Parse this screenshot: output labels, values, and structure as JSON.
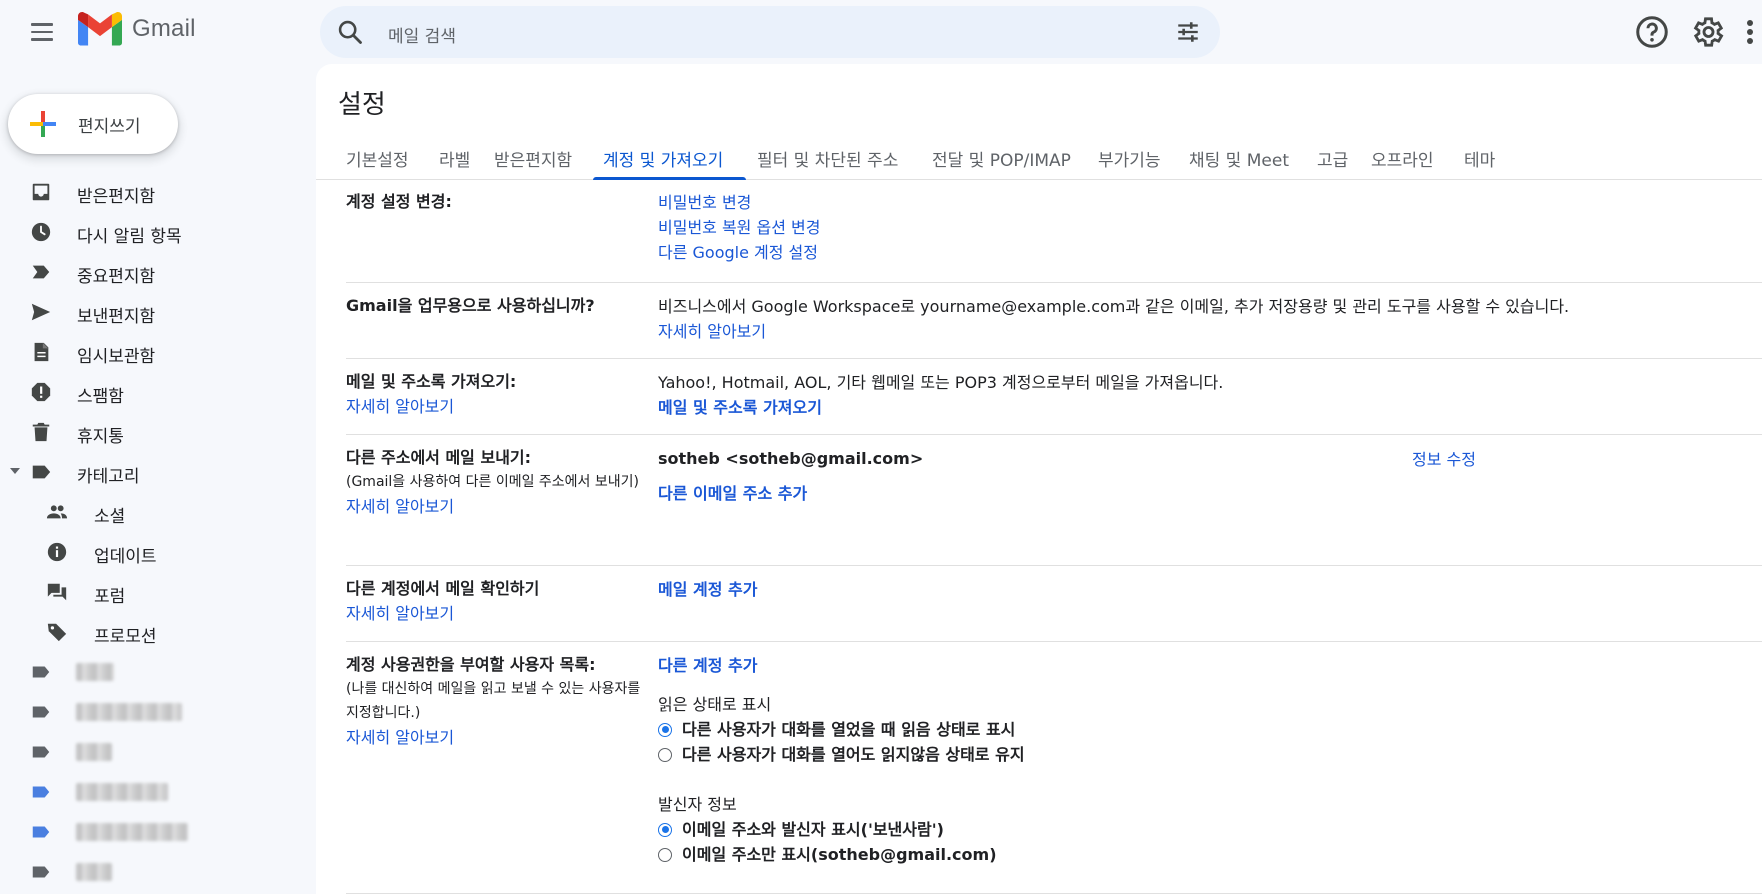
{
  "app": {
    "name": "Gmail"
  },
  "search": {
    "placeholder": "메일 검색"
  },
  "compose": {
    "label": "편지쓰기"
  },
  "sidebar": {
    "items": [
      {
        "label": "받은편지함",
        "icon": "inbox-icon"
      },
      {
        "label": "다시 알림 항목",
        "icon": "clock-icon"
      },
      {
        "label": "중요편지함",
        "icon": "important-icon"
      },
      {
        "label": "보낸편지함",
        "icon": "send-icon"
      },
      {
        "label": "임시보관함",
        "icon": "draft-icon"
      },
      {
        "label": "스팸함",
        "icon": "spam-icon"
      },
      {
        "label": "휴지통",
        "icon": "trash-icon"
      },
      {
        "label": "카테고리",
        "icon": "label-icon"
      }
    ],
    "categories": [
      {
        "label": "소셜",
        "icon": "people-icon"
      },
      {
        "label": "업데이트",
        "icon": "info-icon"
      },
      {
        "label": "포럼",
        "icon": "forum-icon"
      },
      {
        "label": "프로모션",
        "icon": "tag-icon"
      }
    ],
    "labels": [
      {
        "color": "#5f6368"
      },
      {
        "color": "#5f6368"
      },
      {
        "color": "#5f6368"
      },
      {
        "color": "#4a7fe0"
      },
      {
        "color": "#4a7fe0"
      },
      {
        "color": "#5f6368"
      }
    ]
  },
  "settings": {
    "title": "설정",
    "tabs": [
      "기본설정",
      "라벨",
      "받은편지함",
      "계정 및 가져오기",
      "필터 및 차단된 주소",
      "전달 및 POP/IMAP",
      "부가기능",
      "채팅 및 Meet",
      "고급",
      "오프라인",
      "테마"
    ],
    "active_tab": "계정 및 가져오기",
    "rows": {
      "change_account": {
        "label": "계정 설정 변경:",
        "links": [
          "비밀번호 변경",
          "비밀번호 복원 옵션 변경",
          "다른 Google 계정 설정"
        ]
      },
      "workspace": {
        "label": "Gmail을 업무용으로 사용하십니까?",
        "text": "비즈니스에서 Google Workspace로 yourname@example.com과 같은 이메일, 추가 저장용량 및 관리 도구를 사용할 수 있습니다.",
        "link": "자세히 알아보기"
      },
      "import": {
        "label": "메일 및 주소록 가져오기:",
        "learn_more": "자세히 알아보기",
        "text": "Yahoo!, Hotmail, AOL, 기타 웹메일 또는 POP3 계정으로부터 메일을 가져옵니다.",
        "action": "메일 및 주소록 가져오기"
      },
      "send_as": {
        "label": "다른 주소에서 메일 보내기:",
        "note": "(Gmail을 사용하여 다른 이메일 주소에서 보내기)",
        "learn_more": "자세히 알아보기",
        "address": "sotheb <sotheb@gmail.com>",
        "edit": "정보 수정",
        "action": "다른 이메일 주소 추가"
      },
      "check_mail": {
        "label": "다른 계정에서 메일 확인하기",
        "learn_more": "자세히 알아보기",
        "action": "메일 계정 추가"
      },
      "grant_access": {
        "label": "계정 사용권한을 부여할 사용자 목록:",
        "note": "(나를 대신하여 메일을 읽고 보낼 수 있는 사용자를 지정합니다.)",
        "learn_more": "자세히 알아보기",
        "action": "다른 계정 추가",
        "read_status_title": "읽은 상태로 표시",
        "read_opt1": "다른 사용자가 대화를 열었을 때 읽음 상태로 표시",
        "read_opt2": "다른 사용자가 대화를 열어도 읽지않음 상태로 유지",
        "sender_title": "발신자 정보",
        "sender_opt1": "이메일 주소와 발신자 표시('보낸사람')",
        "sender_opt2": "이메일 주소만 표시(sotheb@gmail.com)"
      }
    }
  }
}
